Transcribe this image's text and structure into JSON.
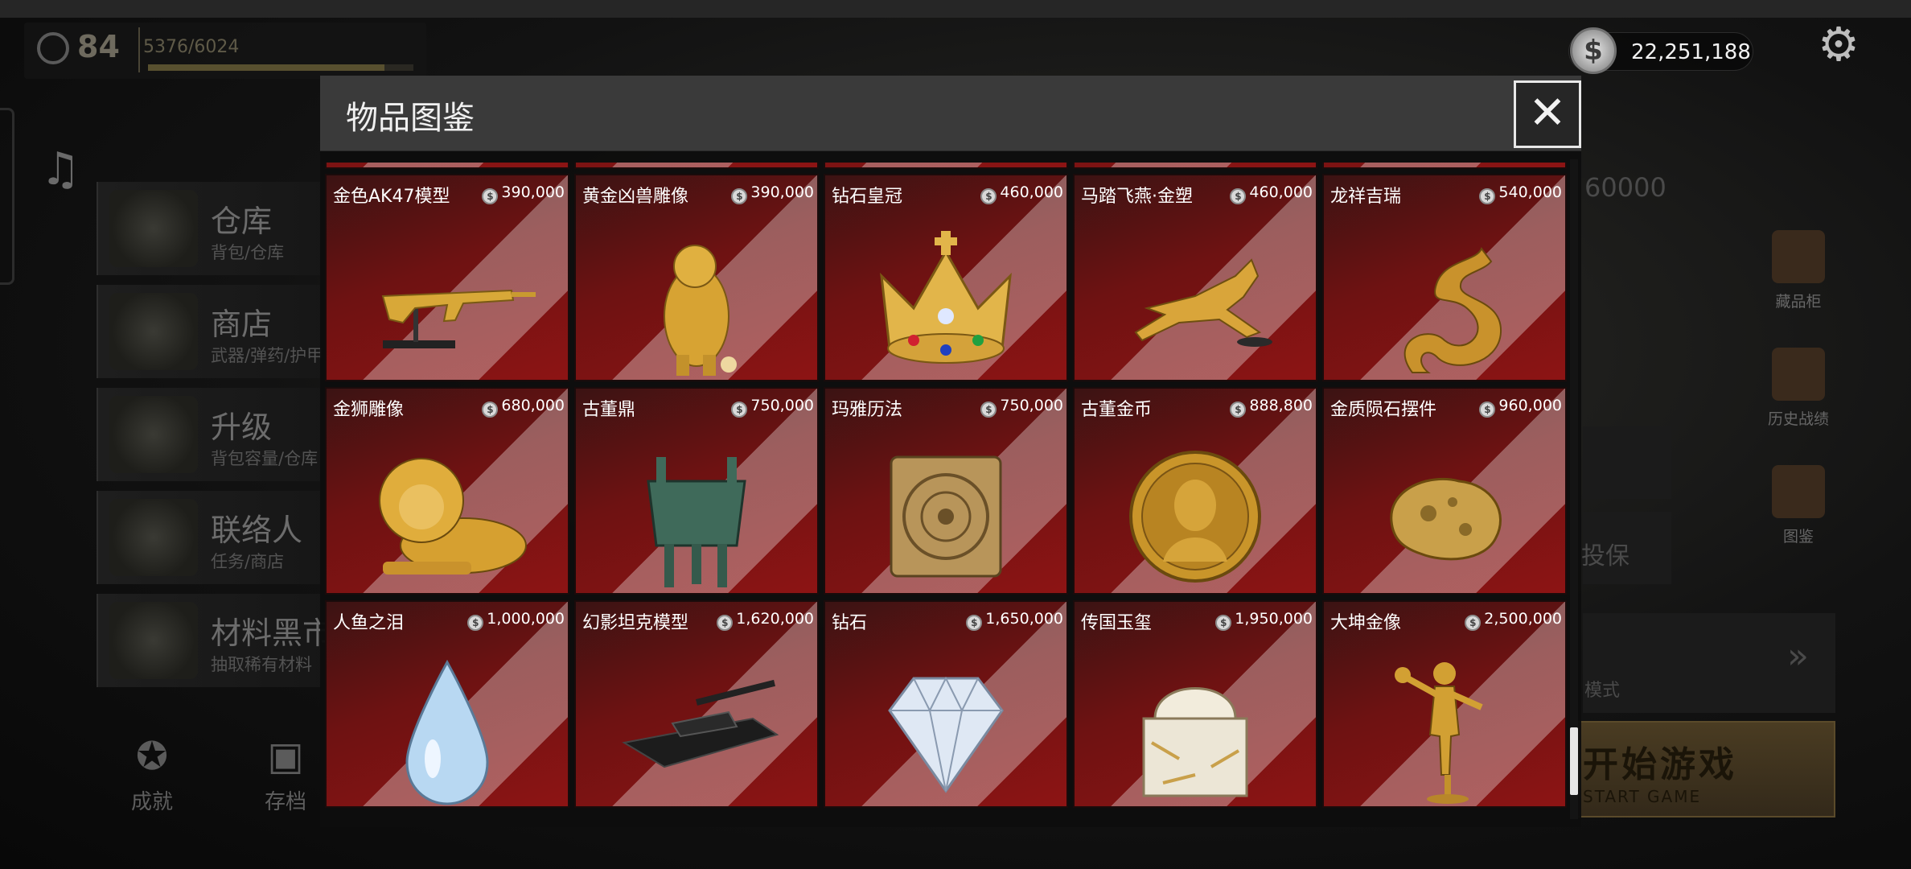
{
  "hud": {
    "level": "84",
    "xp_text": "5376/6024",
    "xp_progress": 0.892,
    "coins": "22,251,188"
  },
  "menu": [
    {
      "title": "仓库",
      "subtitle": "背包/仓库"
    },
    {
      "title": "商店",
      "subtitle": "武器/弹药/护甲"
    },
    {
      "title": "升级",
      "subtitle": "背包容量/仓库"
    },
    {
      "title": "联络人",
      "subtitle": "任务/商店"
    },
    {
      "title": "材料黑市",
      "subtitle": "抽取稀有材料"
    }
  ],
  "bottom_nav": [
    {
      "label": "成就"
    },
    {
      "label": "存档"
    }
  ],
  "right_panel": {
    "value_text": "60000",
    "cabinet_label": "藏品柜",
    "history_label": "历史战绩",
    "codex_label": "图鉴",
    "insure_text": "投保",
    "mode_text": "模式",
    "start_label": "开始游戏",
    "start_sub": "START GAME"
  },
  "modal": {
    "title": "物品图鉴",
    "close_symbol": "✕"
  },
  "items": [
    {
      "name": "金色AK47模型",
      "price": "390,000",
      "art": "golden-rifle"
    },
    {
      "name": "黄金凶兽雕像",
      "price": "390,000",
      "art": "golden-beast"
    },
    {
      "name": "钻石皇冠",
      "price": "460,000",
      "art": "crown"
    },
    {
      "name": "马踏飞燕·金塑",
      "price": "460,000",
      "art": "golden-horse"
    },
    {
      "name": "龙祥吉瑞",
      "price": "540,000",
      "art": "golden-dragon"
    },
    {
      "name": "金狮雕像",
      "price": "680,000",
      "art": "golden-lion"
    },
    {
      "name": "古董鼎",
      "price": "750,000",
      "art": "bronze-cauldron"
    },
    {
      "name": "玛雅历法",
      "price": "750,000",
      "art": "maya-calendar"
    },
    {
      "name": "古董金币",
      "price": "888,800",
      "art": "gold-coin"
    },
    {
      "name": "金质陨石摆件",
      "price": "960,000",
      "art": "gold-meteorite"
    },
    {
      "name": "人鱼之泪",
      "price": "1,000,000",
      "art": "teardrop"
    },
    {
      "name": "幻影坦克模型",
      "price": "1,620,000",
      "art": "tank"
    },
    {
      "name": "钻石",
      "price": "1,650,000",
      "art": "diamond"
    },
    {
      "name": "传国玉玺",
      "price": "1,950,000",
      "art": "jade-seal"
    },
    {
      "name": "大坤金像",
      "price": "2,500,000",
      "art": "golden-figure"
    }
  ],
  "scroll": {
    "position": 0.9
  }
}
